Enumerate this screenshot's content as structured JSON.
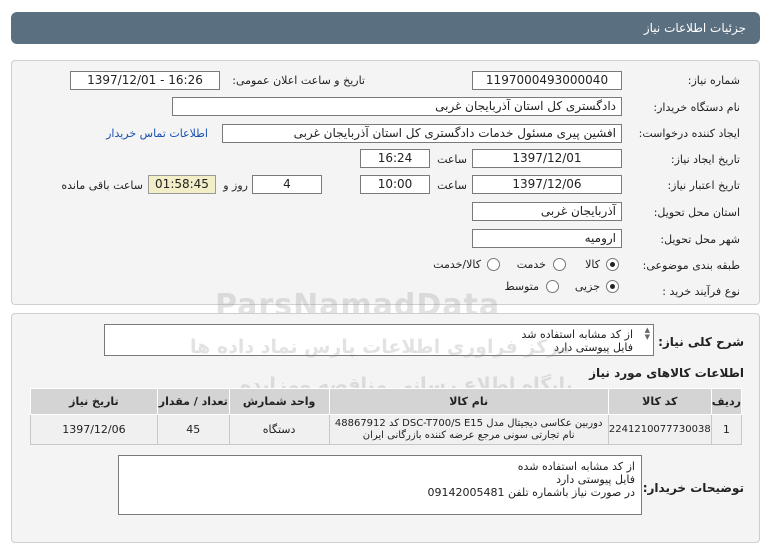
{
  "header": {
    "title": "جزئیات اطلاعات نیاز"
  },
  "form": {
    "need_number_label": "شماره نیاز:",
    "need_number": "1197000493000040",
    "announce_label": "تاریخ و ساعت اعلان عمومی:",
    "announce_value": "1397/12/01 - 16:26",
    "buyer_org_label": "نام دستگاه خریدار:",
    "buyer_org": "دادگستری کل استان آذربایجان غربی",
    "requester_label": "ایجاد کننده درخواست:",
    "requester": "افشین پیری مسئول خدمات دادگستری کل استان آذربایجان غربی",
    "contact_link": "اطلاعات تماس خریدار",
    "created_label": "تاریخ ایجاد نیاز:",
    "created_date": "1397/12/01",
    "hour_label": "ساعت",
    "created_time": "16:24",
    "validity_label": "تاریخ اعتبار نیاز:",
    "validity_date": "1397/12/06",
    "validity_time": "10:00",
    "days_value": "4",
    "days_label": "روز و",
    "remaining_time": "01:58:45",
    "remaining_label": "ساعت باقی مانده",
    "province_label": "استان محل تحویل:",
    "province": "آذربایجان غربی",
    "city_label": "شهر محل تحویل:",
    "city": "ارومیه",
    "category_label": "طبقه بندی موضوعی:",
    "category_options": [
      "کالا",
      "خدمت",
      "کالا/خدمت"
    ],
    "category_selected": "کالا",
    "process_label": "نوع فرآیند خرید :",
    "process_options": [
      "جزیی",
      "متوسط"
    ],
    "process_selected": "جزیی"
  },
  "summary": {
    "label": "شرح کلی نیاز:",
    "line1": "از کد مشابه استفاده شد",
    "line2": "فایل پیوستی دارد"
  },
  "items": {
    "section_title": "اطلاعات کالاهای مورد نیاز",
    "columns": [
      "ردیف",
      "کد کالا",
      "نام کالا",
      "واحد شمارش",
      "تعداد / مقدار",
      "تاریخ نیاز"
    ],
    "rows": [
      {
        "row": "1",
        "code": "2241210077730038",
        "name_line1": "دوربین عکاسی دیجیتال مدل DSC-T700/S E15 کد 48867912",
        "name_line2": "نام تجارتی سونی مرجع عرضه کننده بازرگانی ایران",
        "unit": "دستگاه",
        "qty": "45",
        "date": "1397/12/06"
      }
    ]
  },
  "buyer_notes": {
    "label": "توضیحات خریدار:",
    "line1": "از کد مشابه استفاده شده",
    "line2": "فایل پیوستی دارد",
    "line3": "در صورت نیاز باشماره تلفن 09142005481"
  },
  "watermark": {
    "brand": "ParsNamadData",
    "line1": "پایگاه اطلاع رسانی مناقصه ومزایده",
    "line2": "مرکز فراوری اطلاعات پارس نماد داده ها"
  }
}
